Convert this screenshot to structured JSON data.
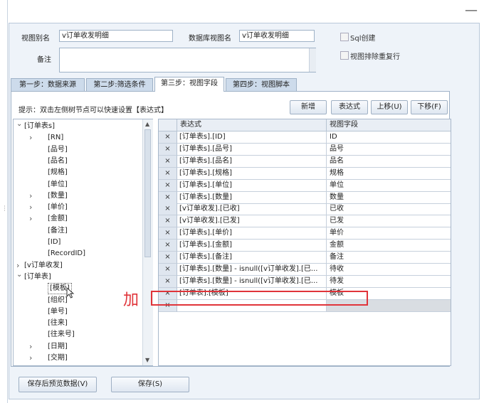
{
  "form": {
    "view_alias_label": "视图别名",
    "view_alias_value": "v订单收发明细",
    "db_view_label": "数据库视图名",
    "db_view_value": "v订单收发明细",
    "sql_label": "Sql创建",
    "dedupe_label": "视图排除重复行",
    "remark_label": "备注",
    "remark_value": ""
  },
  "tabs": [
    {
      "label": "第一步：数据来源"
    },
    {
      "label": "第二步:筛选条件"
    },
    {
      "label": "第三步：视图字段",
      "active": true
    },
    {
      "label": "第四步：视图脚本"
    }
  ],
  "hint": "提示：双击左侧树节点可以快速设置【表达式】",
  "toolbar": {
    "add": "新增",
    "expr": "表达式",
    "up": "上移(U)",
    "down": "下移(F)"
  },
  "tree": [
    {
      "label": "[订单表s]",
      "level": 0,
      "arrow": "expanded"
    },
    {
      "label": "[RN]",
      "level": 1,
      "arrow": "collapsed"
    },
    {
      "label": "[品号]",
      "level": 1,
      "arrow": "none"
    },
    {
      "label": "[品名]",
      "level": 1,
      "arrow": "none"
    },
    {
      "label": "[规格]",
      "level": 1,
      "arrow": "none"
    },
    {
      "label": "[单位]",
      "level": 1,
      "arrow": "none"
    },
    {
      "label": "[数量]",
      "level": 1,
      "arrow": "collapsed"
    },
    {
      "label": "[单价]",
      "level": 1,
      "arrow": "collapsed"
    },
    {
      "label": "[金额]",
      "level": 1,
      "arrow": "collapsed"
    },
    {
      "label": "[备注]",
      "level": 1,
      "arrow": "none"
    },
    {
      "label": "[ID]",
      "level": 1,
      "arrow": "none"
    },
    {
      "label": "[RecordID]",
      "level": 1,
      "arrow": "none"
    },
    {
      "label": "[v订单收发]",
      "level": 0,
      "arrow": "collapsed"
    },
    {
      "label": "[订单表]",
      "level": 0,
      "arrow": "expanded"
    },
    {
      "label": "[模板]",
      "level": 1,
      "arrow": "none",
      "selected": true
    },
    {
      "label": "[组织]",
      "level": 1,
      "arrow": "none"
    },
    {
      "label": "[单号]",
      "level": 1,
      "arrow": "none"
    },
    {
      "label": "[往来]",
      "level": 1,
      "arrow": "none"
    },
    {
      "label": "[往来号]",
      "level": 1,
      "arrow": "none"
    },
    {
      "label": "[日期]",
      "level": 1,
      "arrow": "collapsed"
    },
    {
      "label": "[交期]",
      "level": 1,
      "arrow": "collapsed"
    }
  ],
  "grid": {
    "col_expr": "表达式",
    "col_field": "视图字段",
    "delete_symbol": "×",
    "rows": [
      {
        "expr": "[订单表s].[ID]",
        "field": "ID"
      },
      {
        "expr": "[订单表s].[品号]",
        "field": "品号"
      },
      {
        "expr": "[订单表s].[品名]",
        "field": "品名"
      },
      {
        "expr": "[订单表s].[规格]",
        "field": "规格"
      },
      {
        "expr": "[订单表s].[单位]",
        "field": "单位"
      },
      {
        "expr": "[订单表s].[数量]",
        "field": "数量"
      },
      {
        "expr": "[v订单收发].[已收]",
        "field": "已收"
      },
      {
        "expr": "[v订单收发].[已发]",
        "field": "已发"
      },
      {
        "expr": "[订单表s].[单价]",
        "field": "单价"
      },
      {
        "expr": "[订单表s].[金额]",
        "field": "金额"
      },
      {
        "expr": "[订单表s].[备注]",
        "field": "备注"
      },
      {
        "expr": "[订单表s].[数量] - isnull([v订单收发].[已...",
        "field": "待收"
      },
      {
        "expr": "[订单表s].[数量] - isnull([v订单收发].[已...",
        "field": "待发"
      },
      {
        "expr": "[订单表].[模板]",
        "field": "模板"
      },
      {
        "expr": "",
        "field": ""
      }
    ]
  },
  "annotation": "加",
  "footer": {
    "save_preview": "保存后预览数据(V)",
    "save": "保存(S)"
  }
}
